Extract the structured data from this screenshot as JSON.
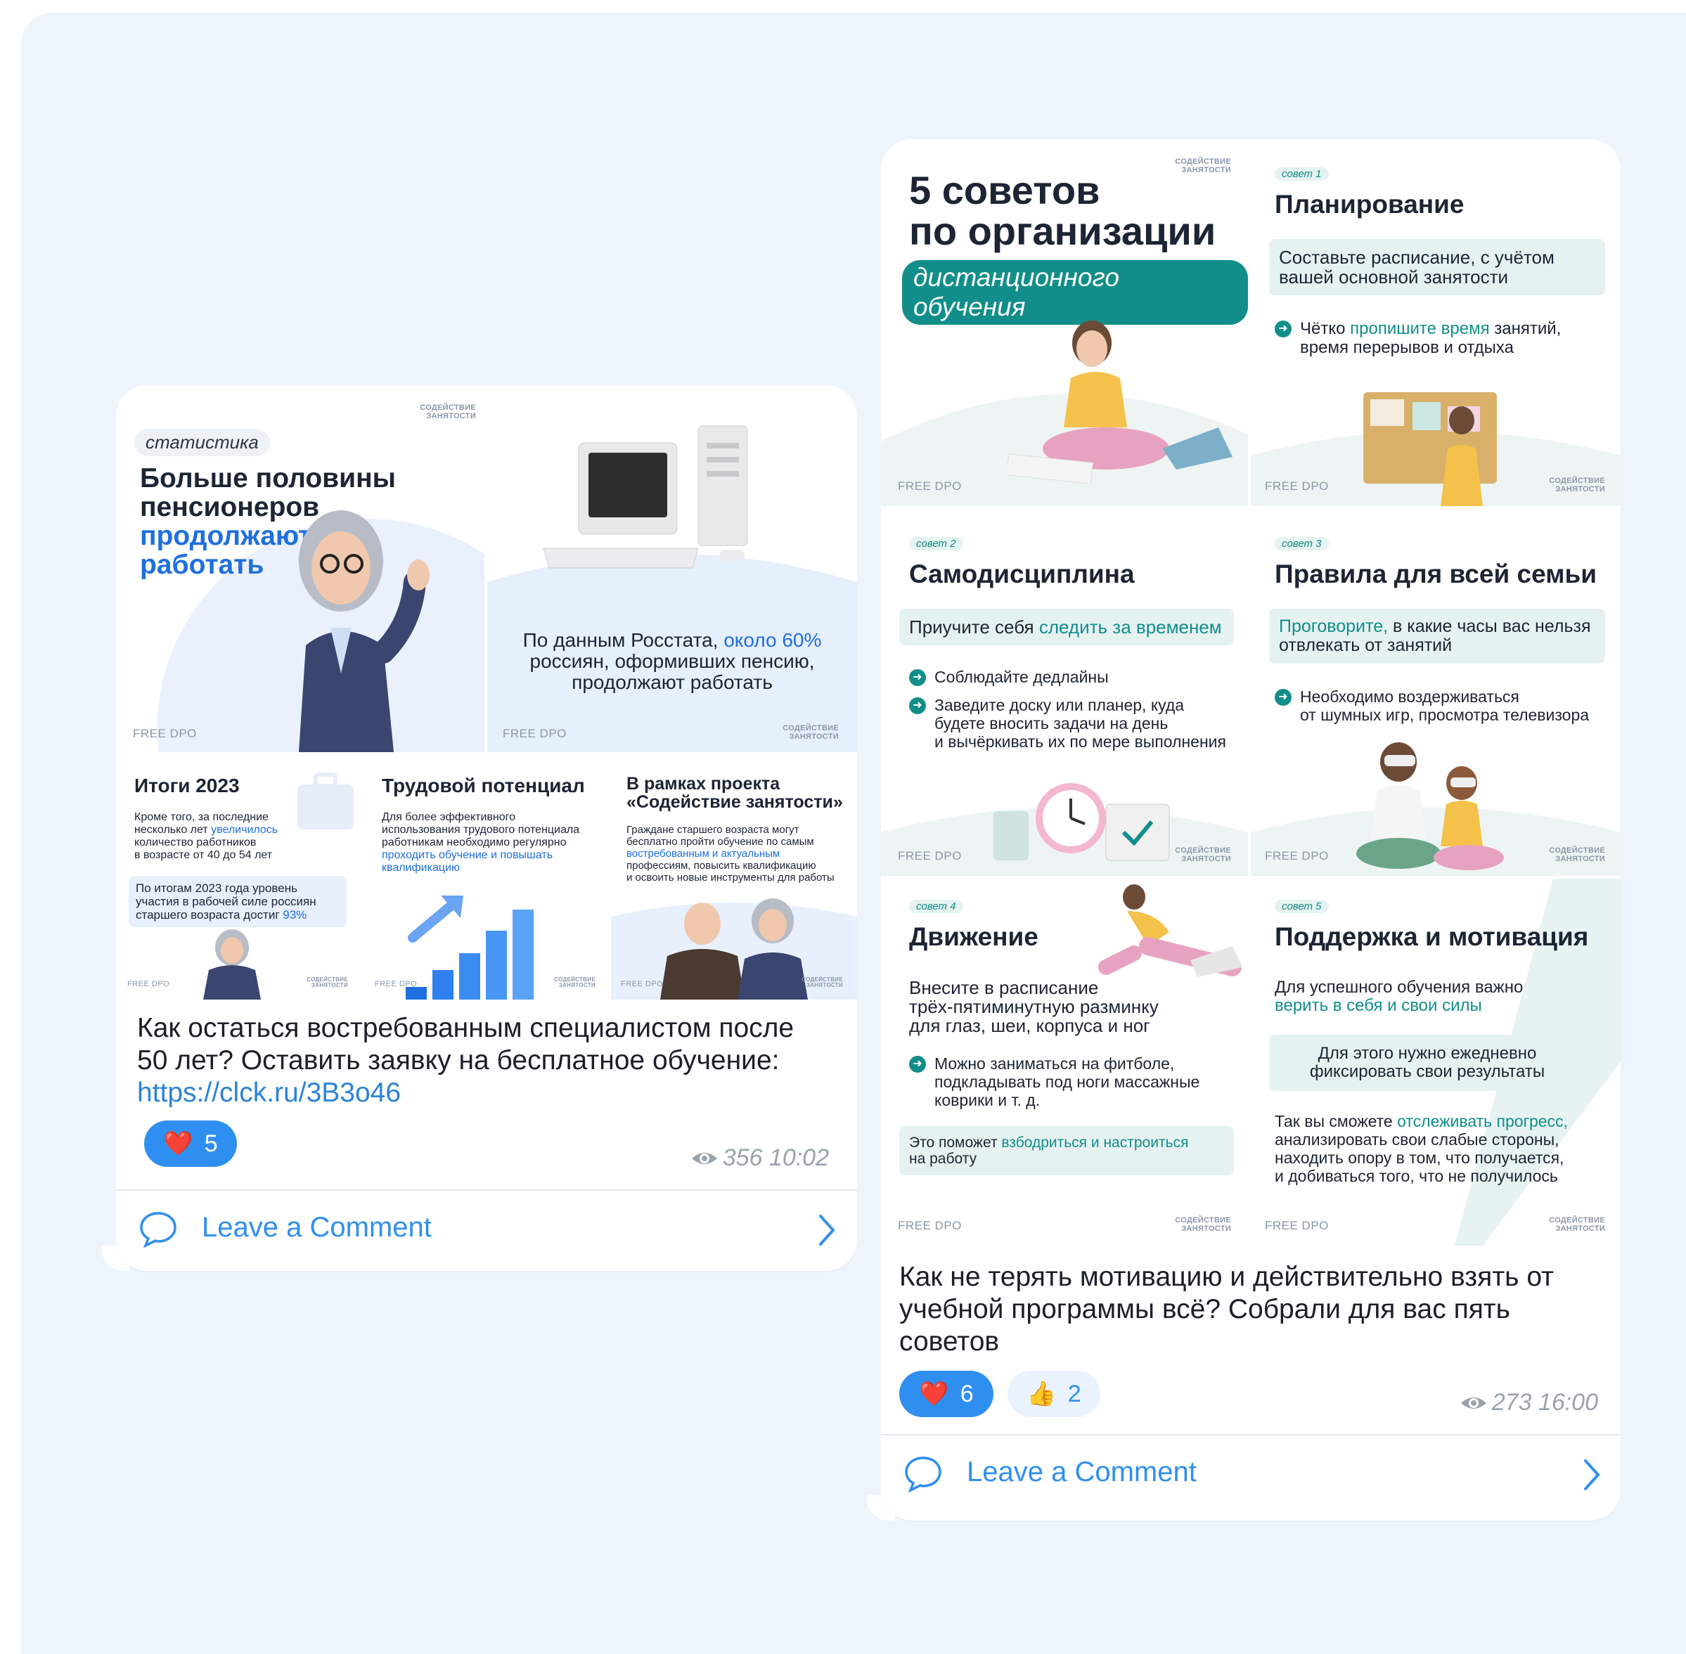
{
  "posts": [
    {
      "slides": {
        "hero": {
          "tag": "статистика",
          "title_line1": "Больше половины",
          "title_line2": "пенсионеров",
          "title_accent1": "продолжают",
          "title_accent2": "работать",
          "brand": "FREE DPO",
          "org": "СОДЕЙСТВИЕ ЗАНЯТОСТИ"
        },
        "rosstat": {
          "text_before": "По данным Росстата, ",
          "text_accent": "около 60%",
          "text_after1": "россиян, оформивших пенсию,",
          "text_after2": "продолжают работать",
          "brand": "FREE DPO",
          "org": "СОДЕЙСТВИЕ ЗАНЯТОСТИ"
        },
        "itogi": {
          "title": "Итоги 2023",
          "body_1": "Кроме того, за последние",
          "body_2_before": "несколько лет ",
          "body_2_accent": "увеличилось",
          "body_3": "количество работников",
          "body_4": "в возрасте от 40 до 54 лет",
          "box_1": "По итогам 2023 года уровень",
          "box_2": "участия в рабочей силе россиян",
          "box_3_before": "старшего возраста достиг ",
          "box_3_accent": "93%",
          "brand": "FREE DPO",
          "org": "СОДЕЙСТВИЕ ЗАНЯТОСТИ"
        },
        "potential": {
          "title": "Трудовой потенциал",
          "body_1": "Для более эффективного",
          "body_2": "использования трудового потенциала",
          "body_3": "работникам необходимо регулярно",
          "body_accent_1": "проходить обучение и повышать",
          "body_accent_2": "квалификацию",
          "brand": "FREE DPO",
          "org": "СОДЕЙСТВИЕ ЗАНЯТОСТИ"
        },
        "project": {
          "title_1": "В рамках проекта",
          "title_2": "«Содействие занятости»",
          "body_1": "Граждане старшего возраста могут",
          "body_2": "бесплатно пройти обучение по самым",
          "body_accent": "востребованным и актуальным",
          "body_3": "профессиям, повысить квалификацию",
          "body_4": "и освоить новые инструменты для работы",
          "brand": "FREE DPO",
          "org": "СОДЕЙСТВИЕ ЗАНЯТОСТИ"
        }
      },
      "text_line1": "Как остаться востребованным специалистом после",
      "text_line2": "50 лет? Оставить заявку на бесплатное обучение:",
      "link": "https://clck.ru/3B3o46",
      "reactions": [
        {
          "emoji": "❤️",
          "count": "5"
        }
      ],
      "views": "356",
      "time": "10:02",
      "comment_label": "Leave a Comment"
    },
    {
      "slides": {
        "cover": {
          "title_1": "5 советов",
          "title_2": "по организации",
          "pill": "дистанционного обучения",
          "brand": "FREE DPO",
          "org": "СОДЕЙСТВИЕ ЗАНЯТОСТИ"
        },
        "tip1": {
          "tag": "совет 1",
          "title": "Планирование",
          "box_1": "Составьте расписание, с учётом",
          "box_2": "вашей основной занятости",
          "bullet_1_before": "Чётко ",
          "bullet_1_accent": "пропишите время",
          "bullet_1_after": " занятий,",
          "bullet_2": "время перерывов и отдыха",
          "brand": "FREE DPO",
          "org": "СОДЕЙСТВИЕ ЗАНЯТОСТИ"
        },
        "tip2": {
          "tag": "совет 2",
          "title": "Самодисциплина",
          "box_before": "Приучите себя ",
          "box_accent": "следить за временем",
          "bullet_1": "Соблюдайте дедлайны",
          "bullet_2_1": "Заведите доску или планер, куда",
          "bullet_2_2": "будете вносить задачи на день",
          "bullet_2_3": "и вычёркивать их по мере выполнения",
          "brand": "FREE DPO",
          "org": "СОДЕЙСТВИЕ ЗАНЯТОСТИ"
        },
        "tip3": {
          "tag": "совет 3",
          "title": "Правила для всей семьи",
          "box_accent": "Проговорите,",
          "box_after": " в какие часы вас нельзя",
          "box_2": "отвлекать от занятий",
          "bullet_1": "Необходимо воздерживаться",
          "bullet_2": "от шумных игр, просмотра телевизора",
          "brand": "FREE DPO",
          "org": "СОДЕЙСТВИЕ ЗАНЯТОСТИ"
        },
        "tip4": {
          "tag": "совет 4",
          "title": "Движение",
          "body_1": "Внесите в расписание",
          "body_2": "трёх-пятиминутную разминку",
          "body_3": "для глаз, шеи, корпуса и ног",
          "bullet_1": "Можно заниматься на фитболе,",
          "bullet_2": "подкладывать под ноги массажные",
          "bullet_3": "коврики и т. д.",
          "box_before": "Это поможет ",
          "box_accent": "взбодриться и настроиться",
          "box_2": "на работу",
          "brand": "FREE DPO",
          "org": "СОДЕЙСТВИЕ ЗАНЯТОСТИ"
        },
        "tip5": {
          "tag": "совет 5",
          "title": "Поддержка и мотивация",
          "body_1": "Для успешного обучения важно",
          "body_accent": "верить в себя и свои силы",
          "box_1": "Для этого нужно ежедневно",
          "box_2": "фиксировать свои результаты",
          "tail_before": "Так вы сможете ",
          "tail_accent": "отслеживать прогресс,",
          "tail_2": "анализировать свои слабые стороны,",
          "tail_3": "находить опору в том, что получается,",
          "tail_4": "и добиваться того, что не получилось",
          "brand": "FREE DPO",
          "org": "СОДЕЙСТВИЕ ЗАНЯТОСТИ"
        }
      },
      "text_line1": "Как не терять мотивацию и действительно взять от",
      "text_line2": "учебной программы всё? Собрали для вас пять",
      "text_line3": "советов",
      "reactions": [
        {
          "emoji": "❤️",
          "count": "6"
        },
        {
          "emoji": "👍",
          "count": "2"
        }
      ],
      "views": "273",
      "time": "16:00",
      "comment_label": "Leave a Comment"
    }
  ],
  "colors": {
    "accent_blue": "#1f6fe0",
    "teal": "#118e8a",
    "reaction_blue": "#2f8ff0",
    "link": "#2b83d8"
  },
  "icons": [
    "eye-icon",
    "comment-bubble-icon",
    "chevron-right-icon",
    "arrow-circle-icon"
  ]
}
